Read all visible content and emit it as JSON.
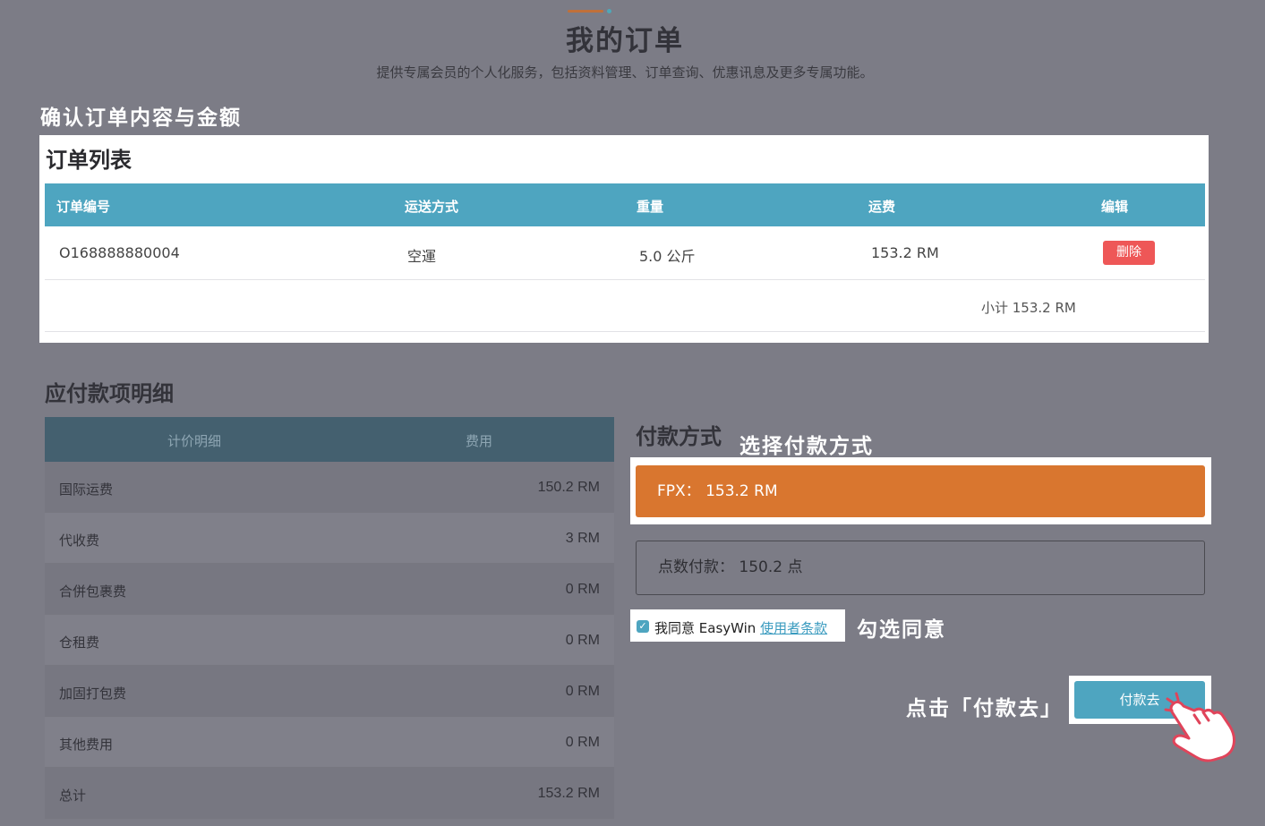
{
  "header": {
    "title": "我的订单",
    "subtitle": "提供专属会员的个人化服务，包括资料管理、订单查询、优惠讯息及更多专属功能。"
  },
  "annotations": {
    "confirm": "确认订单内容与金额",
    "select_payment": "选择付款方式",
    "check_agree": "勾选同意",
    "click_pay": "点击「付款去」"
  },
  "order_list": {
    "title": "订单列表",
    "columns": [
      "订单编号",
      "运送方式",
      "重量",
      "运费",
      "编辑"
    ],
    "rows": [
      {
        "order_no": "O168888880004",
        "shipping": "空運",
        "weight": "5.0 公斤",
        "fee": "153.2 RM",
        "action": "删除"
      }
    ],
    "subtotal": "小计 153.2 RM"
  },
  "payable": {
    "title": "应付款项明细",
    "columns": [
      "计价明细",
      "费用"
    ],
    "rows": [
      {
        "label": "国际运费",
        "value": "150.2 RM"
      },
      {
        "label": "代收费",
        "value": "3 RM"
      },
      {
        "label": "合併包裹费",
        "value": "0 RM"
      },
      {
        "label": "仓租费",
        "value": "0 RM"
      },
      {
        "label": "加固打包费",
        "value": "0 RM"
      },
      {
        "label": "其他费用",
        "value": "0 RM"
      },
      {
        "label": "总计",
        "value": "153.2 RM"
      }
    ]
  },
  "payment": {
    "title": "付款方式",
    "fpx": "FPX： 153.2 RM",
    "points": "点数付款： 150.2 点",
    "agree_prefix": "我同意 EasyWin ",
    "agree_link": "使用者条款",
    "agree_checked": true,
    "pay_button": "付款去"
  },
  "colors": {
    "accent": "#4ea5c0",
    "fpx": "#d9762f",
    "danger": "#ee5757",
    "overlay": "#7c7c86"
  }
}
